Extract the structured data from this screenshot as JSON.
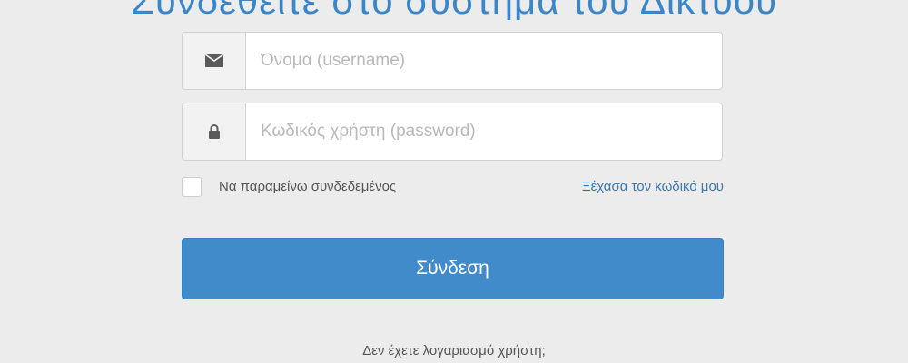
{
  "header": {
    "title": "Συνδεθείτε στο σύστημα του Δικτύου"
  },
  "form": {
    "username": {
      "placeholder": "Όνομα (username)",
      "icon": "envelope-icon"
    },
    "password": {
      "placeholder": "Κωδικός χρήστη (password)",
      "icon": "lock-icon"
    },
    "remember_label": "Να παραμείνω συνδεδεμένος",
    "forgot_link": "Ξέχασα τον κωδικό μου",
    "login_button": "Σύνδεση",
    "no_account_text": "Δεν έχετε λογαριασμό χρήστη;"
  },
  "colors": {
    "accent": "#428bca",
    "link": "#3a78b5",
    "background": "#ececec"
  }
}
